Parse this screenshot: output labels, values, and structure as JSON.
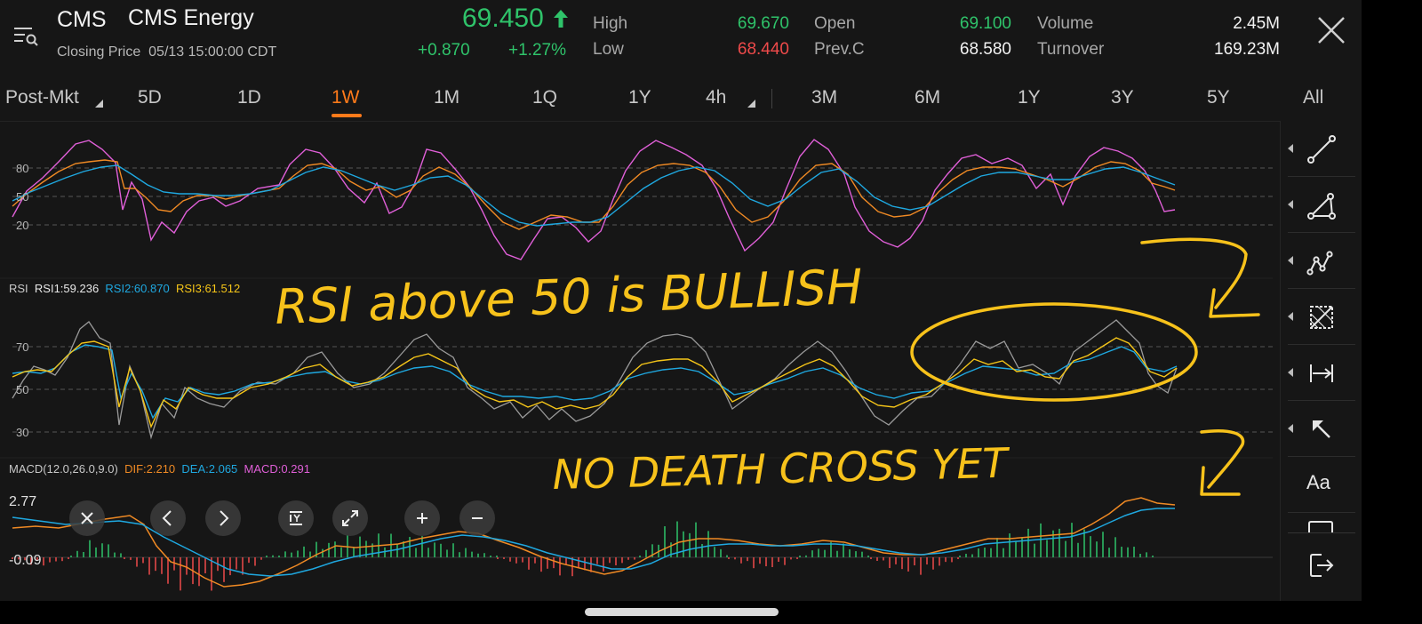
{
  "header": {
    "ticker": "CMS",
    "company": "CMS Energy",
    "closing_label": "Closing Price",
    "closing_time": "05/13 15:00:00 CDT",
    "price": "69.450",
    "change": "+0.870",
    "change_pct": "+1.27%",
    "stats": {
      "high_label": "High",
      "high": "69.670",
      "low_label": "Low",
      "low": "68.440",
      "open_label": "Open",
      "open": "69.100",
      "prevc_label": "Prev.C",
      "prevc": "68.580",
      "volume_label": "Volume",
      "volume": "2.45M",
      "turnover_label": "Turnover",
      "turnover": "169.23M"
    }
  },
  "tabs": [
    "Post-Mkt",
    "5D",
    "1D",
    "1W",
    "1M",
    "1Q",
    "1Y",
    "4h",
    "3M",
    "6M",
    "1Y",
    "3Y",
    "5Y",
    "All"
  ],
  "active_tab": "1W",
  "colors": {
    "up": "#2fc36a",
    "down": "#ef4a4a",
    "accent": "#ff7a1a",
    "kdj_k": "#e05fd8",
    "kdj_d": "#f08a24",
    "kdj_j": "#1fa8e0",
    "rsi1": "#cfcfcf",
    "rsi2": "#1fa8e0",
    "rsi3": "#f5c518",
    "dif": "#f08a24",
    "dea": "#1fa8e0",
    "annotation": "#f7c21b"
  },
  "kdj": {
    "y_labels": [
      "80",
      "50",
      "20"
    ]
  },
  "rsi": {
    "name": "RSI",
    "rsi1": "RSI1:59.236",
    "rsi2": "RSI2:60.870",
    "rsi3": "RSI3:61.512",
    "y_labels": [
      "70",
      "50",
      "30"
    ]
  },
  "macd": {
    "name": "MACD(12.0,26.0,9.0)",
    "dif": "DIF:2.210",
    "dea": "DEA:2.065",
    "macd": "MACD:0.291",
    "y_top": "2.77",
    "y_bottom": "-0.09"
  },
  "annotations": {
    "line1": "RSI above 50 is BULLISH",
    "line2": "NO DEATH CROSS YET"
  },
  "chart_controls": [
    "close-icon",
    "chevron-left-icon",
    "chevron-right-icon",
    "y-axis-icon",
    "expand-icon",
    "zoom-in-icon",
    "zoom-out-icon"
  ],
  "tools": [
    "line-tool-icon",
    "triangle-tool-icon",
    "pattern-tool-icon",
    "fib-tool-icon",
    "range-tool-icon",
    "arrow-tool-icon",
    "text-tool-icon",
    "rectangle-tool-icon",
    "exit-icon"
  ],
  "tool_text": "Aa"
}
